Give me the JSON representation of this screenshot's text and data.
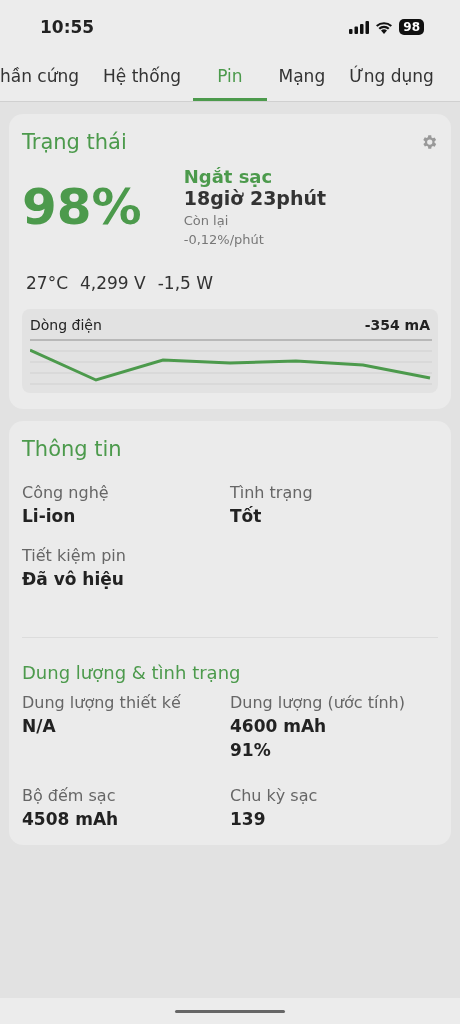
{
  "status_bar": {
    "time": "10:55",
    "battery": "98"
  },
  "tabs": [
    {
      "label": "hần cứng",
      "selected": false
    },
    {
      "label": "Hệ thống",
      "selected": false
    },
    {
      "label": "Pin",
      "selected": true
    },
    {
      "label": "Mạng",
      "selected": false
    },
    {
      "label": "Ứng dụng",
      "selected": false
    }
  ],
  "status_card": {
    "title": "Trạng thái",
    "percent": "98%",
    "state": "Ngắt sạc",
    "time_left": "18giờ 23phút",
    "time_left_label": "Còn lại",
    "rate": "-0,12%/phút",
    "temperature": "27°C",
    "voltage": "4,299 V",
    "power": "-1,5 W",
    "current_label": "Dòng điện",
    "current_value": "-354 mA"
  },
  "info_card": {
    "title": "Thông tin",
    "fields": [
      {
        "label": "Công nghệ",
        "values": [
          "Li-ion"
        ]
      },
      {
        "label": "Tình trạng",
        "values": [
          "Tốt"
        ]
      },
      {
        "label": "Tiết kiệm pin",
        "values": [
          "Đã vô hiệu"
        ]
      }
    ],
    "capacity_title": "Dung lượng & tình trạng",
    "capacity_fields": [
      {
        "label": "Dung lượng thiết kế",
        "values": [
          "N/A"
        ]
      },
      {
        "label": "Dung lượng (ước tính)",
        "values": [
          "4600 mAh",
          "91%"
        ]
      },
      {
        "label": "Bộ đếm sạc",
        "values": [
          "4508 mAh"
        ]
      },
      {
        "label": "Chu kỳ sạc",
        "values": [
          "139"
        ]
      }
    ]
  }
}
